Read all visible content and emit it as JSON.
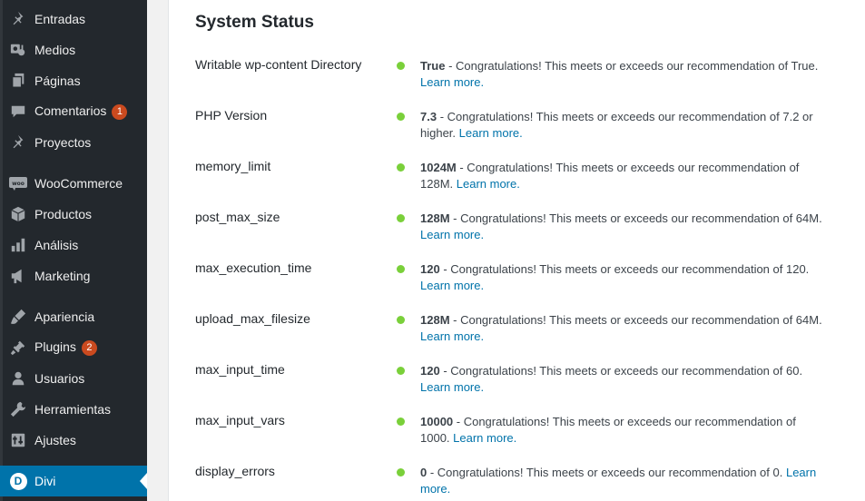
{
  "sidebar": {
    "items": [
      {
        "label": "Entradas",
        "icon": "pin-icon"
      },
      {
        "label": "Medios",
        "icon": "media-icon"
      },
      {
        "label": "Páginas",
        "icon": "pages-icon"
      },
      {
        "label": "Comentarios",
        "icon": "comment-icon",
        "badge": "1"
      },
      {
        "label": "Proyectos",
        "icon": "pin-icon"
      },
      {
        "label": "WooCommerce",
        "icon": "woo-icon"
      },
      {
        "label": "Productos",
        "icon": "box-icon"
      },
      {
        "label": "Análisis",
        "icon": "bar-chart-icon"
      },
      {
        "label": "Marketing",
        "icon": "megaphone-icon"
      },
      {
        "label": "Apariencia",
        "icon": "brush-icon"
      },
      {
        "label": "Plugins",
        "icon": "plug-icon",
        "badge": "2"
      },
      {
        "label": "Usuarios",
        "icon": "user-icon"
      },
      {
        "label": "Herramientas",
        "icon": "wrench-icon"
      },
      {
        "label": "Ajustes",
        "icon": "settings-icon"
      },
      {
        "label": "Divi",
        "icon": "divi-logo-icon",
        "active": true
      }
    ]
  },
  "main": {
    "title": "System Status",
    "learn_more": "Learn more.",
    "rows": [
      {
        "key": "Writable wp-content Directory",
        "value": "True",
        "text": " - Congratulations! This meets or exceeds our recommendation of True. "
      },
      {
        "key": "PHP Version",
        "value": "7.3",
        "text": " - Congratulations! This meets or exceeds our recommendation of 7.2 or higher. "
      },
      {
        "key": "memory_limit",
        "value": "1024M",
        "text": " - Congratulations! This meets or exceeds our recommendation of 128M. "
      },
      {
        "key": "post_max_size",
        "value": "128M",
        "text": " - Congratulations! This meets or exceeds our recommendation of 64M. "
      },
      {
        "key": "max_execution_time",
        "value": "120",
        "text": " - Congratulations! This meets or exceeds our recommendation of 120. "
      },
      {
        "key": "upload_max_filesize",
        "value": "128M",
        "text": " - Congratulations! This meets or exceeds our recommendation of 64M. "
      },
      {
        "key": "max_input_time",
        "value": "120",
        "text": " - Congratulations! This meets or exceeds our recommendation of 60. "
      },
      {
        "key": "max_input_vars",
        "value": "10000",
        "text": " - Congratulations! This meets or exceeds our recommendation of 1000. "
      },
      {
        "key": "display_errors",
        "value": "0",
        "text": " - Congratulations! This meets or exceeds our recommendation of 0. "
      }
    ]
  },
  "colors": {
    "sidebar_bg": "#23282d",
    "active_bg": "#0073aa",
    "status_ok": "#7ad03a",
    "link": "#0073aa",
    "badge": "#ca4a1f"
  }
}
